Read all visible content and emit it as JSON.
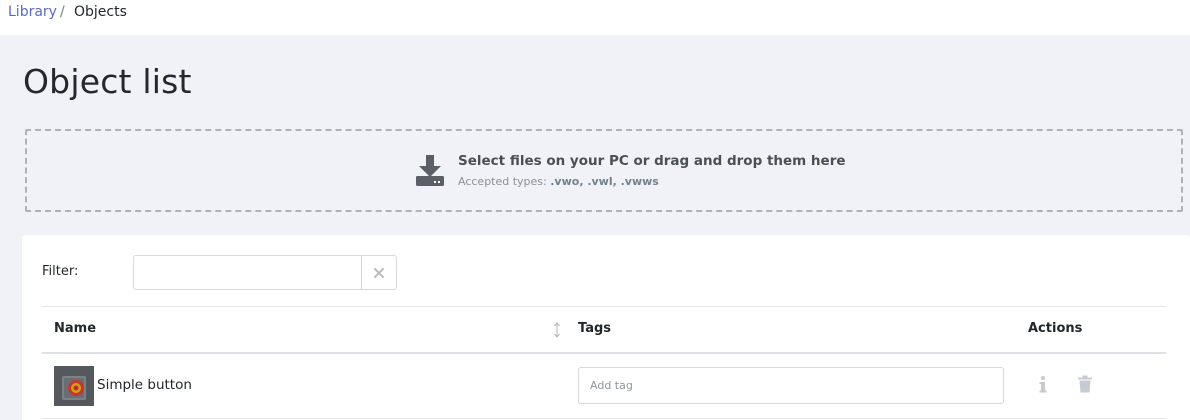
{
  "breadcrumb": {
    "parent": "Library",
    "separator": "/",
    "current": "Objects"
  },
  "page": {
    "title": "Object list"
  },
  "dropzone": {
    "main_text": "Select files on your PC or drag and drop them here",
    "accepted_label": "Accepted types:",
    "accepted_types": ".vwo, .vwl, .vwws",
    "icon": "download-tray-icon"
  },
  "filter": {
    "label": "Filter:",
    "value": "",
    "clear_icon": "close-icon"
  },
  "table": {
    "columns": {
      "name": "Name",
      "tags": "Tags",
      "actions": "Actions"
    },
    "rows": [
      {
        "name": "Simple button",
        "tag_placeholder": "Add tag",
        "thumbnail": "object-thumbnail",
        "actions": [
          "info-icon",
          "trash-icon"
        ]
      }
    ]
  },
  "colors": {
    "link": "#5c6bc0",
    "page_bg": "#f1f2f7",
    "card_bg": "#ffffff",
    "border": "#d5d8dc"
  }
}
